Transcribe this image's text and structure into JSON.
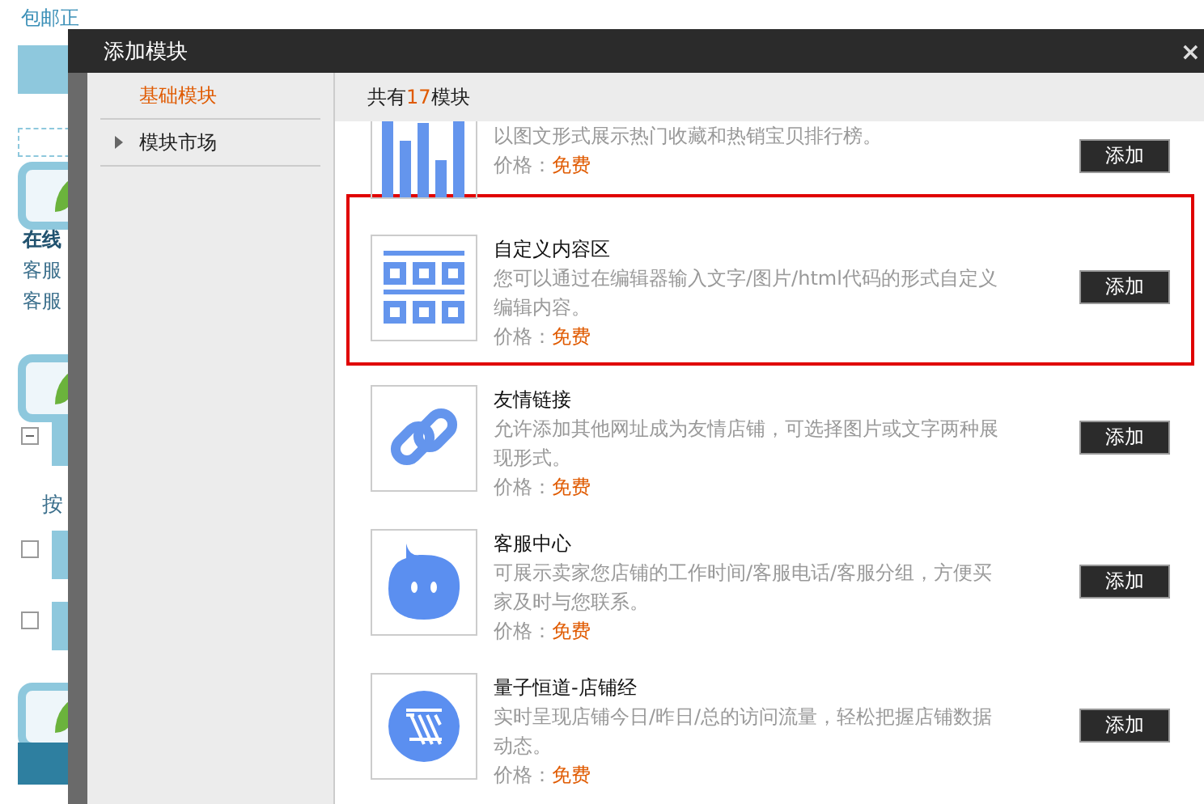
{
  "background_page": {
    "top_link": "包邮正",
    "texts": [
      "在线",
      "客服",
      "客服"
    ],
    "label": "按",
    "checkboxes": [
      {
        "checked": false
      },
      {
        "checked": false
      }
    ]
  },
  "dialog": {
    "title": "添加模块",
    "close": "×"
  },
  "sidebar": {
    "items": [
      {
        "label": "基础模块",
        "selected": true,
        "kind": "plain"
      },
      {
        "label": "模块市场",
        "selected": false,
        "kind": "arrow"
      }
    ]
  },
  "header": {
    "prefix": "共有",
    "count": "17",
    "suffix": "模块"
  },
  "modules": [
    {
      "description": "以图文形式展示热门收藏和热销宝贝排行榜。",
      "price_label": "价格：",
      "price": "免费",
      "button": "添加",
      "highlighted": false
    },
    {
      "title": "自定义内容区",
      "description": "您可以通过在编辑器输入文字/图片/html代码的形式自定义编辑内容。",
      "price_label": "价格：",
      "price": "免费",
      "button": "添加",
      "highlighted": true
    },
    {
      "title": "友情链接",
      "description": "允许添加其他网址成为友情店铺，可选择图片或文字两种展现形式。",
      "price_label": "价格：",
      "price": "免费",
      "button": "添加",
      "highlighted": false
    },
    {
      "title": "客服中心",
      "description": "可展示卖家您店铺的工作时间/客服电话/客服分组，方便买家及时与您联系。",
      "price_label": "价格：",
      "price": "免费",
      "button": "添加",
      "highlighted": false
    },
    {
      "title": "量子恒道-店铺经",
      "description": "实时呈现店铺今日/昨日/总的访问流量，轻松把握店铺数据动态。",
      "price_label": "价格：",
      "price": "免费",
      "button": "添加",
      "highlighted": false
    }
  ]
}
